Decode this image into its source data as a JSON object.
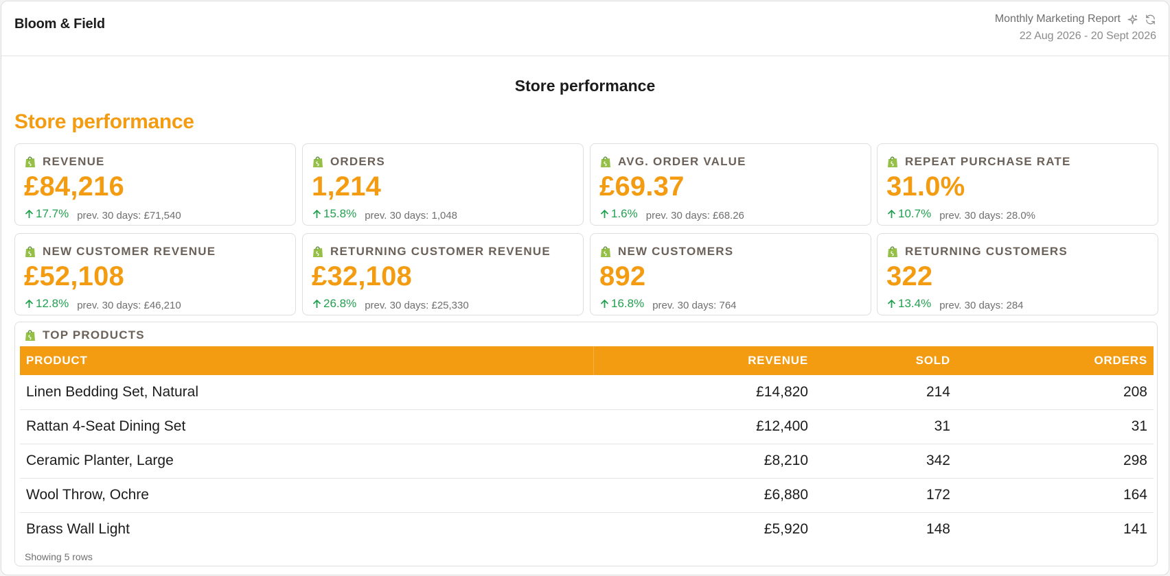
{
  "header": {
    "brand": "Bloom & Field",
    "report_title": "Monthly Marketing Report",
    "date_range": "22 Aug 2026 - 20 Sept 2026",
    "icons": [
      "sparkle-icon",
      "refresh-icon"
    ]
  },
  "page_title": "Store performance",
  "section_title": "Store performance",
  "colors": {
    "accent": "#f39c12",
    "positive": "#22a050",
    "shopify_green": "#95bf47"
  },
  "kpis": [
    {
      "label": "REVENUE",
      "value": "£84,216",
      "delta": "17.7%",
      "prev": "prev. 30 days: £71,540"
    },
    {
      "label": "ORDERS",
      "value": "1,214",
      "delta": "15.8%",
      "prev": "prev. 30 days: 1,048"
    },
    {
      "label": "AVG. ORDER VALUE",
      "value": "£69.37",
      "delta": "1.6%",
      "prev": "prev. 30 days: £68.26"
    },
    {
      "label": "REPEAT PURCHASE RATE",
      "value": "31.0%",
      "delta": "10.7%",
      "prev": "prev. 30 days: 28.0%"
    },
    {
      "label": "NEW CUSTOMER REVENUE",
      "value": "£52,108",
      "delta": "12.8%",
      "prev": "prev. 30 days: £46,210"
    },
    {
      "label": "RETURNING CUSTOMER REVENUE",
      "value": "£32,108",
      "delta": "26.8%",
      "prev": "prev. 30 days: £25,330"
    },
    {
      "label": "NEW CUSTOMERS",
      "value": "892",
      "delta": "16.8%",
      "prev": "prev. 30 days: 764"
    },
    {
      "label": "RETURNING CUSTOMERS",
      "value": "322",
      "delta": "13.4%",
      "prev": "prev. 30 days: 284"
    }
  ],
  "top_products": {
    "label": "TOP PRODUCTS",
    "columns": [
      "PRODUCT",
      "REVENUE",
      "SOLD",
      "ORDERS"
    ],
    "rows": [
      [
        "Linen Bedding Set, Natural",
        "£14,820",
        "214",
        "208"
      ],
      [
        "Rattan 4-Seat Dining Set",
        "£12,400",
        "31",
        "31"
      ],
      [
        "Ceramic Planter, Large",
        "£8,210",
        "342",
        "298"
      ],
      [
        "Wool Throw, Ochre",
        "£6,880",
        "172",
        "164"
      ],
      [
        "Brass Wall Light",
        "£5,920",
        "148",
        "141"
      ]
    ],
    "footer": "Showing 5 rows"
  }
}
